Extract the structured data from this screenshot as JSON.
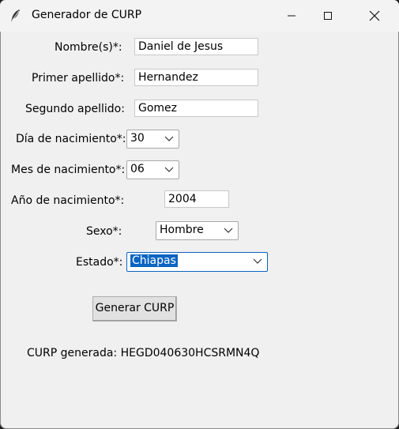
{
  "window": {
    "title": "Generador de CURP"
  },
  "form": {
    "nombre_label": "Nombre(s)*:",
    "nombre_value": "Daniel de Jesus",
    "primer_apellido_label": "Primer apellido*:",
    "primer_apellido_value": "Hernandez",
    "segundo_apellido_label": "Segundo apellido:",
    "segundo_apellido_value": "Gomez",
    "dia_label": "Día de nacimiento*:",
    "dia_value": "30",
    "mes_label": "Mes de nacimiento*:",
    "mes_value": "06",
    "anio_label": "Año de nacimiento*:",
    "anio_value": "2004",
    "sexo_label": "Sexo*:",
    "sexo_value": "Hombre",
    "estado_label": "Estado*:",
    "estado_value": "Chiapas"
  },
  "actions": {
    "generate_label": "Generar CURP"
  },
  "result": {
    "text": "CURP generada: HEGD040630HCSRMN4Q"
  },
  "colors": {
    "accent": "#0a64c2",
    "window_bg": "#f0f0f0"
  }
}
